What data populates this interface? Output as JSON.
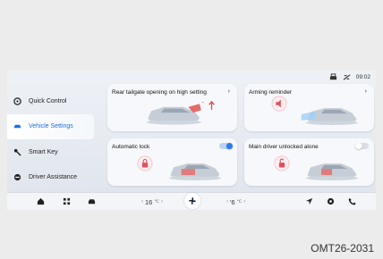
{
  "status_bar": {
    "clock": "09:02",
    "icons": [
      "printer-icon",
      "signal-icon"
    ]
  },
  "sidebar": {
    "items": [
      {
        "label": "Quick Control",
        "icon": "steering-wheel-icon",
        "active": false
      },
      {
        "label": "Vehicle Settings",
        "icon": "car-icon",
        "active": true
      },
      {
        "label": "Smart Key",
        "icon": "key-icon",
        "active": false
      },
      {
        "label": "Driver Assistance",
        "icon": "assist-icon",
        "active": false
      }
    ]
  },
  "cards": [
    {
      "title": "Rear tailgate opening on high setting",
      "control": "chevron",
      "chevron": "›"
    },
    {
      "title": "Arming reminder",
      "control": "chevron",
      "chevron": "›"
    },
    {
      "title": "Automatic lock",
      "control": "toggle",
      "state": "on"
    },
    {
      "title": "Main driver unlocked alone",
      "control": "toggle",
      "state": "off"
    }
  ],
  "bottom_bar": {
    "left_icons": [
      "home-icon",
      "apps-icon",
      "car-icon"
    ],
    "temp_left": {
      "dec": "‹",
      "value": "16",
      "unit": "℃",
      "inc": "›"
    },
    "fan_icon": "fan-icon",
    "temp_right": {
      "dec": "‹",
      "value": "'6",
      "unit": "℃",
      "inc": "›"
    },
    "right_icons": [
      "navigation-icon",
      "media-icon",
      "phone-icon"
    ]
  },
  "figure_code": "OMT26-2031",
  "colors": {
    "accent": "#2a7bf0",
    "lock_icon": "#e0505a",
    "tailgate_arrow": "#e04848"
  }
}
